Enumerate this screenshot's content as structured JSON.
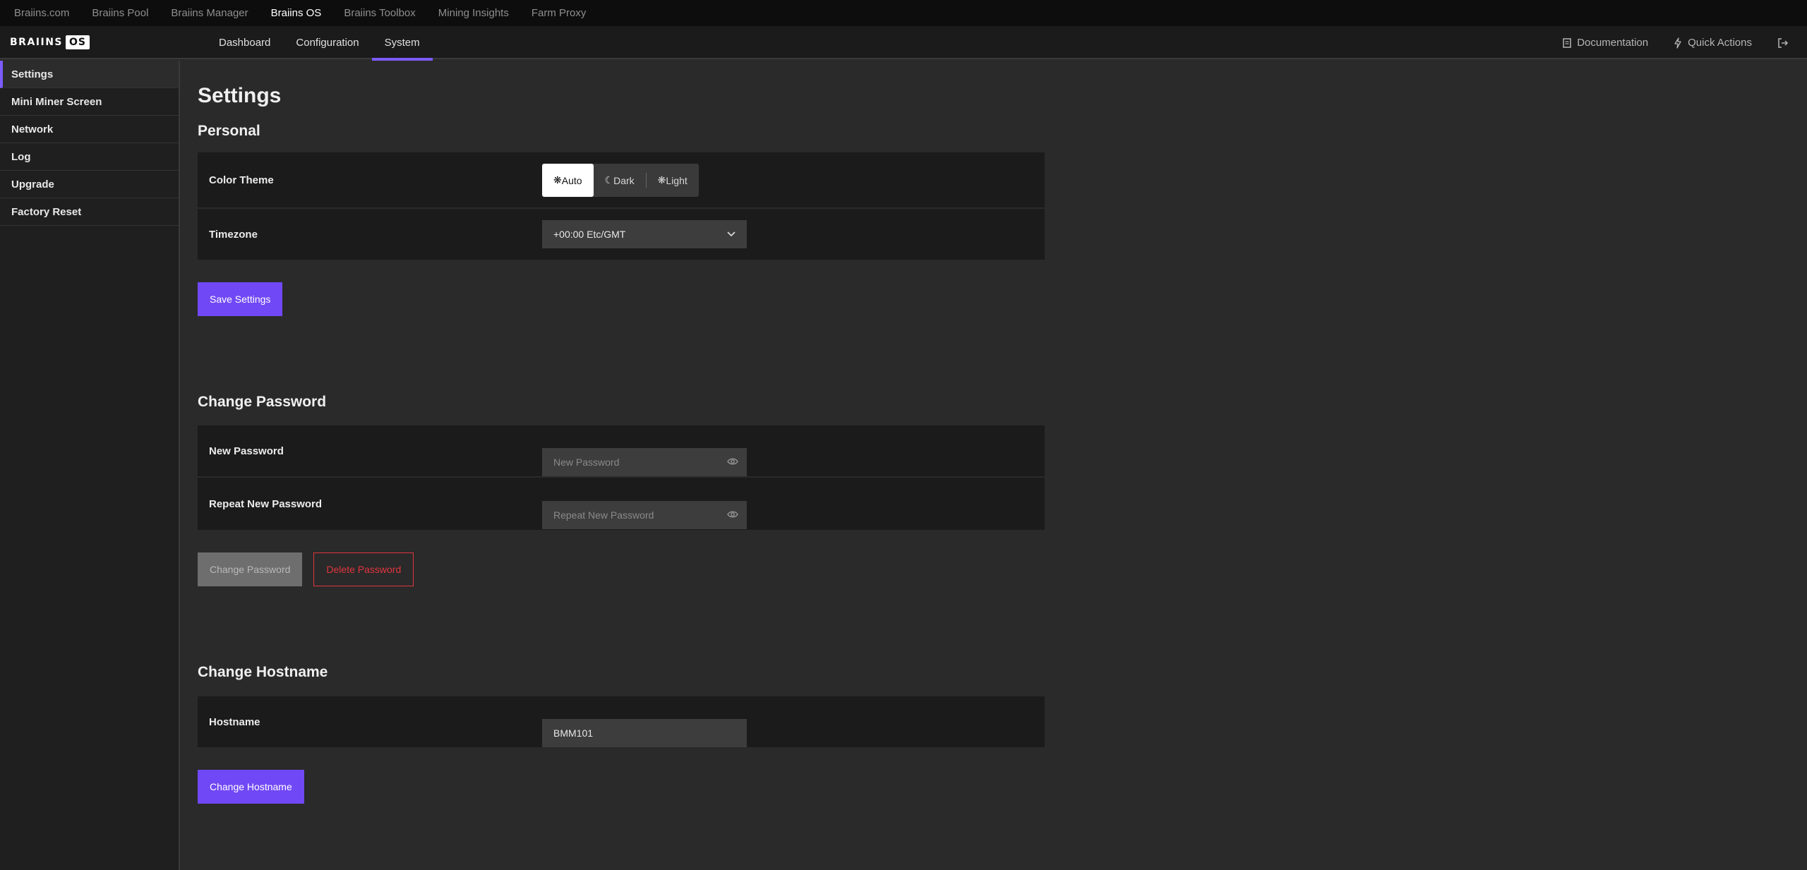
{
  "topbar": {
    "links": [
      "Braiins.com",
      "Braiins Pool",
      "Braiins Manager",
      "Braiins OS",
      "Braiins Toolbox",
      "Mining Insights",
      "Farm Proxy"
    ],
    "active": "Braiins OS"
  },
  "header": {
    "logo_word": "BRAIINS",
    "logo_box": "OS",
    "tabs": [
      "Dashboard",
      "Configuration",
      "System"
    ],
    "active_tab": "System",
    "documentation": "Documentation",
    "quick_actions": "Quick Actions"
  },
  "sidebar": {
    "items": [
      "Settings",
      "Mini Miner Screen",
      "Network",
      "Log",
      "Upgrade",
      "Factory Reset"
    ],
    "active": "Settings"
  },
  "page": {
    "title": "Settings",
    "personal": {
      "heading": "Personal",
      "color_theme_label": "Color Theme",
      "theme_options": [
        "Auto",
        "Dark",
        "Light"
      ],
      "theme_selected": "Auto",
      "timezone_label": "Timezone",
      "timezone_value": "+00:00 Etc/GMT",
      "save_button": "Save Settings"
    },
    "password": {
      "heading": "Change Password",
      "new_label": "New Password",
      "new_placeholder": "New Password",
      "repeat_label": "Repeat New Password",
      "repeat_placeholder": "Repeat New Password",
      "change_button": "Change Password",
      "delete_button": "Delete Password"
    },
    "hostname": {
      "heading": "Change Hostname",
      "label": "Hostname",
      "value": "BMM101",
      "button": "Change Hostname"
    }
  },
  "colors": {
    "accent": "#7148f5",
    "danger": "#e0353f",
    "background": "#2a2a2a",
    "panel": "#1b1b1b"
  }
}
